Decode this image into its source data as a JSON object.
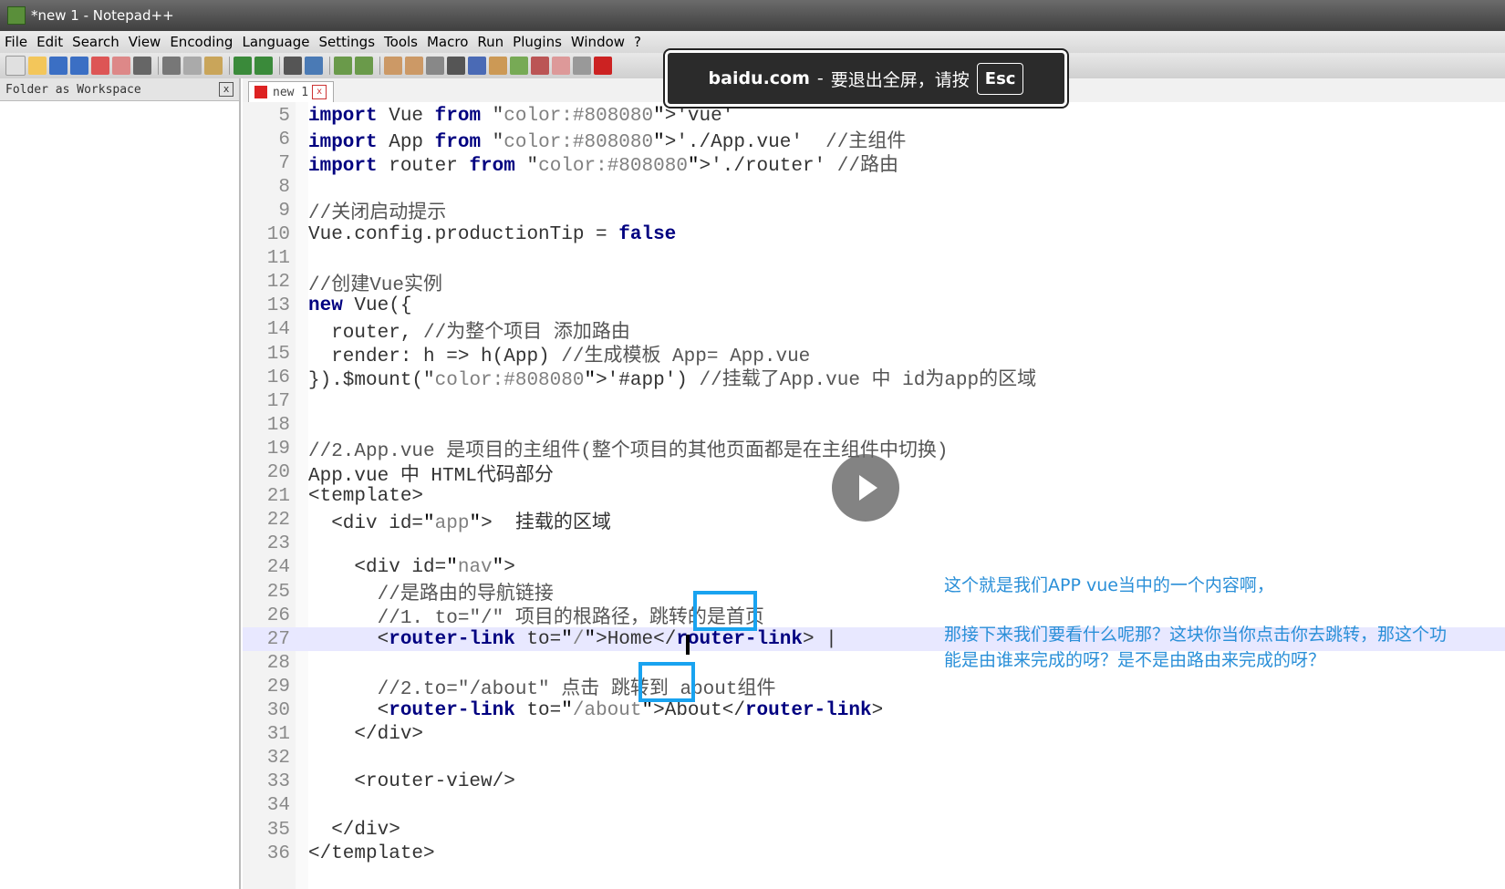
{
  "window": {
    "title": "*new 1 - Notepad++"
  },
  "menu": [
    "File",
    "Edit",
    "Search",
    "View",
    "Encoding",
    "Language",
    "Settings",
    "Tools",
    "Macro",
    "Run",
    "Plugins",
    "Window",
    "?"
  ],
  "sidebar": {
    "title": "Folder as Workspace",
    "close_label": "x"
  },
  "tab": {
    "label": "new 1",
    "close_label": "x"
  },
  "fullscreen_notice": {
    "domain": "baidu.com",
    "separator": "-",
    "message": "要退出全屏，请按",
    "key": "Esc"
  },
  "editor": {
    "lines": [
      {
        "n": "5",
        "text": "import Vue from 'vue'"
      },
      {
        "n": "6",
        "text": "import App from './App.vue'  //主组件"
      },
      {
        "n": "7",
        "text": "import router from './router' //路由"
      },
      {
        "n": "8",
        "text": ""
      },
      {
        "n": "9",
        "text": "//关闭启动提示"
      },
      {
        "n": "10",
        "text": "Vue.config.productionTip = false"
      },
      {
        "n": "11",
        "text": ""
      },
      {
        "n": "12",
        "text": "//创建Vue实例"
      },
      {
        "n": "13",
        "text": "new Vue({"
      },
      {
        "n": "14",
        "text": "  router, //为整个项目 添加路由"
      },
      {
        "n": "15",
        "text": "  render: h => h(App) //生成模板 App= App.vue"
      },
      {
        "n": "16",
        "text": "}).$mount('#app') //挂载了App.vue 中 id为app的区域"
      },
      {
        "n": "17",
        "text": ""
      },
      {
        "n": "18",
        "text": ""
      },
      {
        "n": "19",
        "text": "//2.App.vue 是项目的主组件(整个项目的其他页面都是在主组件中切换)"
      },
      {
        "n": "20",
        "text": "App.vue 中 HTML代码部分"
      },
      {
        "n": "21",
        "text": "<template>"
      },
      {
        "n": "22",
        "text": "  <div id=\"app\">  挂载的区域"
      },
      {
        "n": "23",
        "text": ""
      },
      {
        "n": "24",
        "text": "    <div id=\"nav\">"
      },
      {
        "n": "25",
        "text": "      //是路由的导航链接"
      },
      {
        "n": "26",
        "text": "      //1. to=\"/\" 项目的根路径，跳转的是首页"
      },
      {
        "n": "27",
        "text": "      <router-link to=\"/\">Home</router-link> |"
      },
      {
        "n": "28",
        "text": ""
      },
      {
        "n": "29",
        "text": "      //2.to=\"/about\" 点击 跳转到 about组件"
      },
      {
        "n": "30",
        "text": "      <router-link to=\"/about\">About</router-link>"
      },
      {
        "n": "31",
        "text": "    </div>"
      },
      {
        "n": "32",
        "text": ""
      },
      {
        "n": "33",
        "text": "    <router-view/>"
      },
      {
        "n": "34",
        "text": ""
      },
      {
        "n": "35",
        "text": "  </div>"
      },
      {
        "n": "36",
        "text": "</template>"
      }
    ],
    "active_line": "27"
  },
  "captions": {
    "line1": "这个就是我们APP vue当中的一个内容啊，",
    "line2": "那接下来我们要看什么呢那？这块你当你点击你去跳转，那这个功\n能是由谁来完成的呀？是不是由路由来完成的呀？"
  },
  "colors": {
    "keyword": "#000080",
    "comment": "#555555",
    "string": "#808080",
    "caption": "#2a8fd8",
    "highlight_box": "#19a3f0"
  }
}
